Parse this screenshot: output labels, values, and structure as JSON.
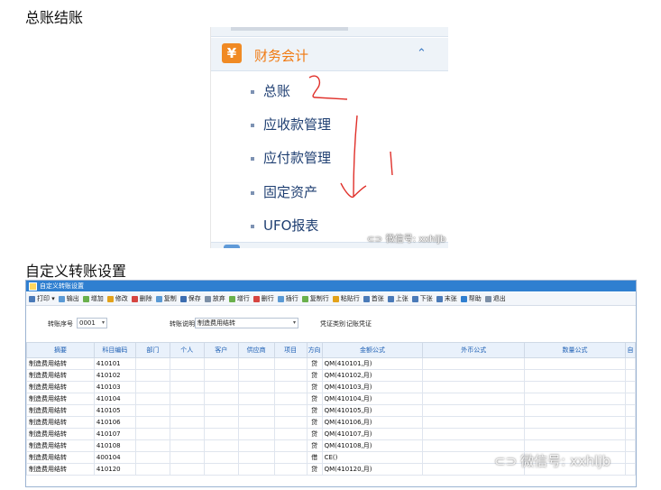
{
  "headings": {
    "first": "总账结账",
    "second": "自定义转账设置"
  },
  "menu": {
    "section_icon_glyph": "¥",
    "section_label": "财务会计",
    "chevron_glyph": "⌃",
    "items": [
      {
        "label": "总账"
      },
      {
        "label": "应收款管理"
      },
      {
        "label": "应付款管理"
      },
      {
        "label": "固定资产"
      },
      {
        "label": "UFO报表"
      }
    ]
  },
  "watermark": {
    "text": "微信号: xxhljb",
    "logo_glyph": "⊂⊃"
  },
  "window": {
    "title": "自定义转账设置",
    "toolbar": [
      {
        "label": "打印 ▾",
        "icon": "print-icon",
        "color": "#4a7ab8"
      },
      {
        "label": "输出",
        "icon": "export-icon",
        "color": "#5a9ad5"
      },
      {
        "label": "增加",
        "icon": "add-icon",
        "color": "#6ab04c"
      },
      {
        "label": "修改",
        "icon": "edit-icon",
        "color": "#e3a21a"
      },
      {
        "label": "删除",
        "icon": "delete-icon",
        "color": "#d64541"
      },
      {
        "label": "复制",
        "icon": "copy-icon",
        "color": "#5a9ad5"
      },
      {
        "label": "保存",
        "icon": "save-icon",
        "color": "#3c6db0"
      },
      {
        "label": "放弃",
        "icon": "discard-icon",
        "color": "#7c8fa6"
      },
      {
        "label": "增行",
        "icon": "add-row-icon",
        "color": "#6ab04c"
      },
      {
        "label": "删行",
        "icon": "delete-row-icon",
        "color": "#d64541"
      },
      {
        "label": "插行",
        "icon": "insert-row-icon",
        "color": "#5a9ad5"
      },
      {
        "label": "复制行",
        "icon": "copy-row-icon",
        "color": "#6ab04c"
      },
      {
        "label": "粘贴行",
        "icon": "paste-row-icon",
        "color": "#e3a21a"
      },
      {
        "label": "首张",
        "icon": "first-icon",
        "color": "#4a7ab8"
      },
      {
        "label": "上张",
        "icon": "prev-icon",
        "color": "#4a7ab8"
      },
      {
        "label": "下张",
        "icon": "next-icon",
        "color": "#4a7ab8"
      },
      {
        "label": "末张",
        "icon": "last-icon",
        "color": "#4a7ab8"
      },
      {
        "label": "帮助",
        "icon": "help-icon",
        "color": "#2f7fd0"
      },
      {
        "label": "退出",
        "icon": "exit-icon",
        "color": "#7c8fa6"
      }
    ],
    "form": {
      "seq_label": "转账序号",
      "seq_value": "0001",
      "desc_label": "转账说明",
      "desc_value": "制造费用结转",
      "voucher_label": "凭证类别",
      "voucher_value": "记账凭证"
    },
    "columns": [
      "摘要",
      "科目编码",
      "部门",
      "个人",
      "客户",
      "供应商",
      "项目",
      "方向",
      "金额公式",
      "外币公式",
      "数量公式",
      "自"
    ],
    "rows": [
      [
        "制造费用结转",
        "410101",
        "",
        "",
        "",
        "",
        "",
        "贷",
        "QM(410101,月)",
        "",
        ""
      ],
      [
        "制造费用结转",
        "410102",
        "",
        "",
        "",
        "",
        "",
        "贷",
        "QM(410102,月)",
        "",
        ""
      ],
      [
        "制造费用结转",
        "410103",
        "",
        "",
        "",
        "",
        "",
        "贷",
        "QM(410103,月)",
        "",
        ""
      ],
      [
        "制造费用结转",
        "410104",
        "",
        "",
        "",
        "",
        "",
        "贷",
        "QM(410104,月)",
        "",
        ""
      ],
      [
        "制造费用结转",
        "410105",
        "",
        "",
        "",
        "",
        "",
        "贷",
        "QM(410105,月)",
        "",
        ""
      ],
      [
        "制造费用结转",
        "410106",
        "",
        "",
        "",
        "",
        "",
        "贷",
        "QM(410106,月)",
        "",
        ""
      ],
      [
        "制造费用结转",
        "410107",
        "",
        "",
        "",
        "",
        "",
        "贷",
        "QM(410107,月)",
        "",
        ""
      ],
      [
        "制造费用结转",
        "410108",
        "",
        "",
        "",
        "",
        "",
        "贷",
        "QM(410108,月)",
        "",
        ""
      ],
      [
        "制造费用结转",
        "400104",
        "",
        "",
        "",
        "",
        "",
        "借",
        "CE()",
        "",
        ""
      ],
      [
        "制造费用结转",
        "410120",
        "",
        "",
        "",
        "",
        "",
        "贷",
        "QM(410120,月)",
        "",
        ""
      ]
    ]
  }
}
